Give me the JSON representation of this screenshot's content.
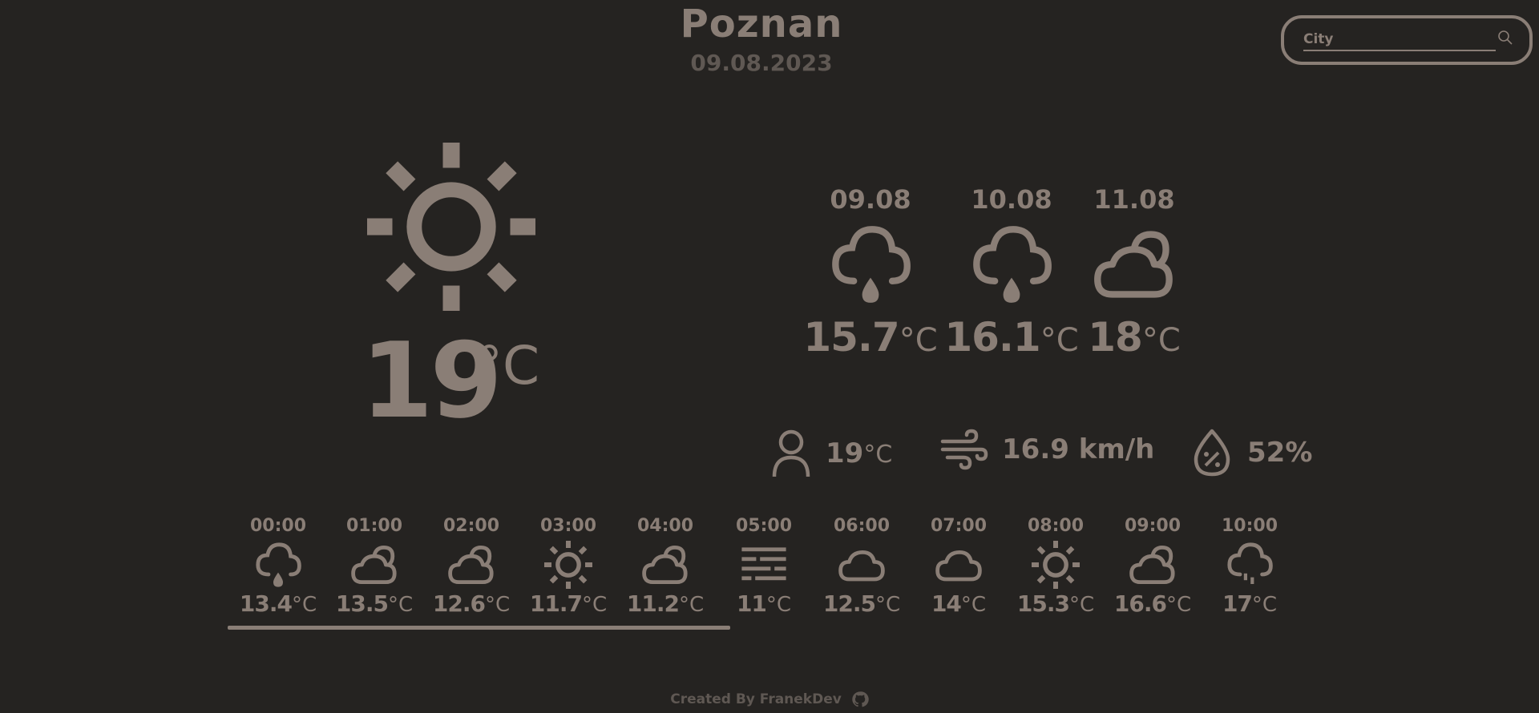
{
  "header": {
    "city": "Poznan",
    "date": "09.08.2023"
  },
  "search": {
    "placeholder": "City",
    "icon": "search-icon"
  },
  "current": {
    "icon": "sun-icon",
    "temp": "19",
    "unit": "°C"
  },
  "daily": [
    {
      "date": "09.08",
      "icon": "rain-cloud-icon",
      "temp": "15.7",
      "unit": "°C"
    },
    {
      "date": "10.08",
      "icon": "rain-cloud-icon",
      "temp": "16.1",
      "unit": "°C"
    },
    {
      "date": "11.08",
      "icon": "partly-cloudy-icon",
      "temp": "18",
      "unit": "°C"
    }
  ],
  "stats": {
    "feels_like": {
      "icon": "person-icon",
      "value": "19",
      "unit": "°C"
    },
    "wind": {
      "icon": "wind-icon",
      "value": "16.9 km/h"
    },
    "humidity": {
      "icon": "humidity-drop-icon",
      "value": "52%"
    }
  },
  "hourly": [
    {
      "time": "00:00",
      "icon": "rain-cloud-icon",
      "temp": "13.4",
      "unit": "°C"
    },
    {
      "time": "01:00",
      "icon": "partly-cloudy-icon",
      "temp": "13.5",
      "unit": "°C"
    },
    {
      "time": "02:00",
      "icon": "partly-cloudy-icon",
      "temp": "12.6",
      "unit": "°C"
    },
    {
      "time": "03:00",
      "icon": "sun-icon",
      "temp": "11.7",
      "unit": "°C"
    },
    {
      "time": "04:00",
      "icon": "partly-cloudy-icon",
      "temp": "11.2",
      "unit": "°C"
    },
    {
      "time": "05:00",
      "icon": "fog-icon",
      "temp": "11",
      "unit": "°C"
    },
    {
      "time": "06:00",
      "icon": "cloud-icon",
      "temp": "12.5",
      "unit": "°C"
    },
    {
      "time": "07:00",
      "icon": "cloud-icon",
      "temp": "14",
      "unit": "°C"
    },
    {
      "time": "08:00",
      "icon": "sun-icon",
      "temp": "15.3",
      "unit": "°C"
    },
    {
      "time": "09:00",
      "icon": "partly-cloudy-icon",
      "temp": "16.6",
      "unit": "°C"
    },
    {
      "time": "10:00",
      "icon": "drizzle-cloud-icon",
      "temp": "17",
      "unit": "°C"
    }
  ],
  "footer": {
    "text": "Created By FranekDev",
    "icon": "github-icon"
  },
  "colors": {
    "background": "#252321",
    "foreground": "#8a7e76",
    "muted": "#5f5853"
  }
}
